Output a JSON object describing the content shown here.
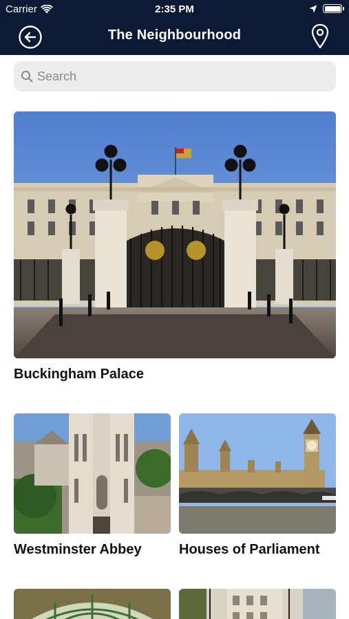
{
  "status_bar": {
    "carrier": "Carrier",
    "time": "2:35 PM"
  },
  "nav": {
    "title": "The Neighbourhood",
    "back_icon": "back-arrow-circle-icon",
    "map_icon": "map-pin-icon"
  },
  "search": {
    "placeholder": "Search",
    "value": ""
  },
  "featured": {
    "name": "Buckingham Palace"
  },
  "places": [
    {
      "name": "Westminster Abbey"
    },
    {
      "name": "Houses of Parliament"
    }
  ],
  "colors": {
    "header_bg": "#0b1a35",
    "search_bg": "#ededee"
  }
}
